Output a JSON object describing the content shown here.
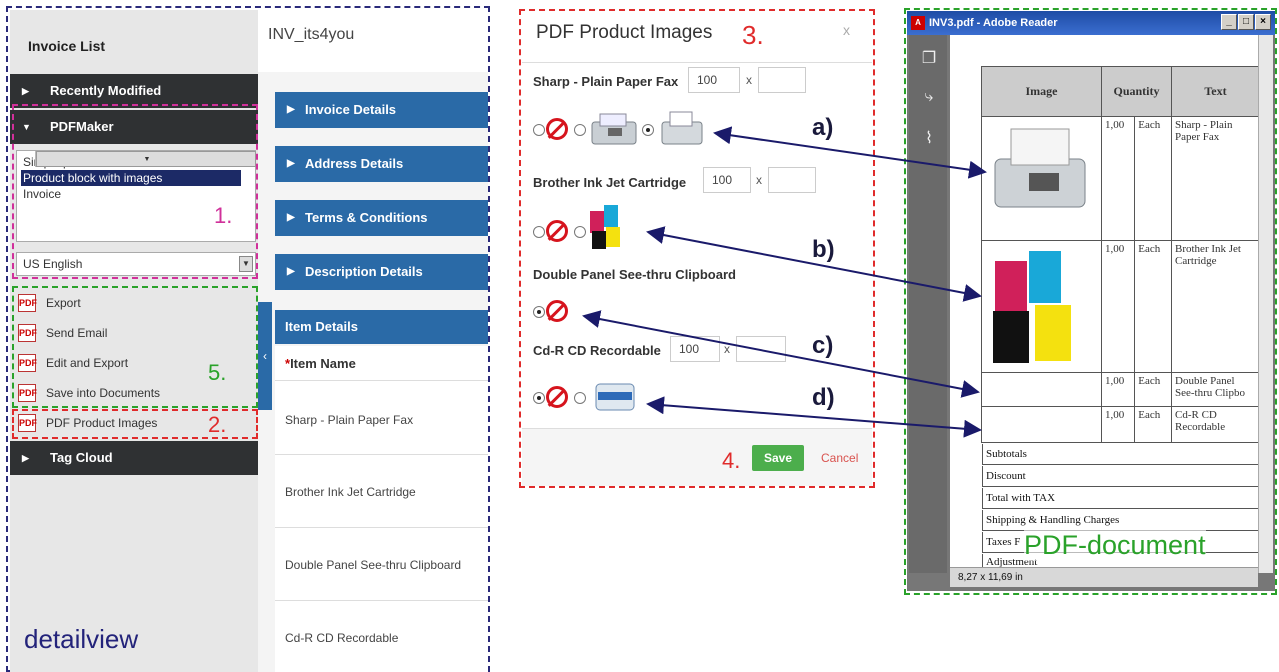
{
  "sidebar": {
    "title": "Invoice List",
    "recently_modified": "Recently Modified",
    "pdfmaker": "PDFMaker",
    "templates": [
      "Simple product block",
      "Product block with images",
      "Invoice"
    ],
    "language": "US English",
    "actions": [
      "Export",
      "Send Email",
      "Edit and Export",
      "Save into Documents"
    ],
    "pdf_product_images": "PDF Product Images",
    "tag_cloud": "Tag Cloud"
  },
  "detail": {
    "record_name": "INV_its4you",
    "blocks": [
      "Invoice Details",
      "Address Details",
      "Terms & Conditions",
      "Description Details"
    ],
    "item_details": "Item Details",
    "item_name_header": "Item Name",
    "item_required_mark": "*",
    "items": [
      "Sharp - Plain Paper Fax",
      "Brother Ink Jet Cartridge",
      "Double Panel See-thru Clipboard",
      "Cd-R CD Recordable"
    ]
  },
  "dialog": {
    "title": "PDF Product Images",
    "close": "x",
    "products": [
      {
        "name": "Sharp - Plain Paper Fax",
        "width": "100",
        "height": "",
        "x": "x"
      },
      {
        "name": "Brother Ink Jet Cartridge",
        "width": "100",
        "height": "",
        "x": "x"
      },
      {
        "name": "Double Panel See-thru Clipboard"
      },
      {
        "name": "Cd-R CD Recordable",
        "width": "100",
        "height": "",
        "x": "x"
      }
    ],
    "save": "Save",
    "cancel": "Cancel"
  },
  "reader": {
    "window_title": "INV3.pdf - Adobe Reader",
    "table_headers": [
      "Image",
      "Quantity",
      "Text"
    ],
    "rows": [
      {
        "qty": "1,00",
        "unit": "Each",
        "text": "Sharp - Plain Paper Fax"
      },
      {
        "qty": "1,00",
        "unit": "Each",
        "text": "Brother Ink Jet Cartridge"
      },
      {
        "qty": "1,00",
        "unit": "Each",
        "text": "Double Panel See-thru Clipbo"
      },
      {
        "qty": "1,00",
        "unit": "Each",
        "text": "Cd-R CD Recordable"
      }
    ],
    "totals": [
      "Subtotals",
      "Discount",
      "Total with TAX",
      "Shipping & Handling Charges",
      "Taxes F",
      "Adjustment"
    ],
    "page_size": "8,27 x 11,69 in"
  },
  "annotations": {
    "n1": "1.",
    "n2": "2.",
    "n3": "3.",
    "n4": "4.",
    "n5": "5.",
    "a": "a)",
    "b": "b)",
    "c": "c)",
    "d": "d)",
    "detailview": "detailview",
    "pdf_document": "PDF-document"
  },
  "colors": {
    "nav_dark": "#2f3133",
    "block_blue": "#2a6aa7",
    "save_green": "#4cae4c",
    "annotation_red": "#e02b2b",
    "annotation_green": "#2aa22a",
    "annotation_magenta": "#d0309a",
    "annotation_navy": "#23237a"
  }
}
